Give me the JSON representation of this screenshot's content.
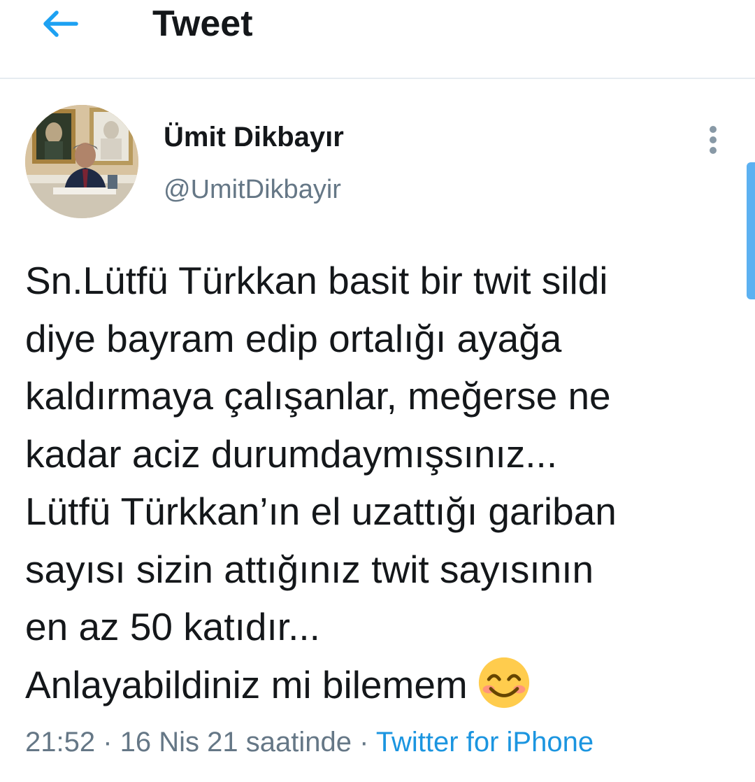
{
  "header": {
    "title": "Tweet",
    "back_icon": "arrow-left-icon",
    "accent_color": "#1da1f2"
  },
  "author": {
    "name": "Ümit Dikbayır",
    "handle": "@UmitDikbayir",
    "avatar": "profile-photo"
  },
  "more_icon": "vertical-ellipsis-icon",
  "tweet": {
    "lines": [
      "Sn.Lütfü Türkkan basit bir twit sildi",
      "diye bayram edip ortalığı ayağa",
      "kaldırmaya çalışanlar, meğerse ne",
      "kadar aciz durumdaymışsınız...",
      "Lütfü Türkkan’ın el uzattığı gariban",
      "sayısı sizin attığınız twit sayısının",
      "en az 50 katıdır...",
      "Anlayabildiniz mi bilemem"
    ],
    "emoji": "smiling-face-with-smiling-eyes-emoji"
  },
  "meta": {
    "time": "21:52",
    "sep1": " · ",
    "date": "16 Nis 21 saatinde",
    "sep2": " · ",
    "source": "Twitter for iPhone"
  }
}
